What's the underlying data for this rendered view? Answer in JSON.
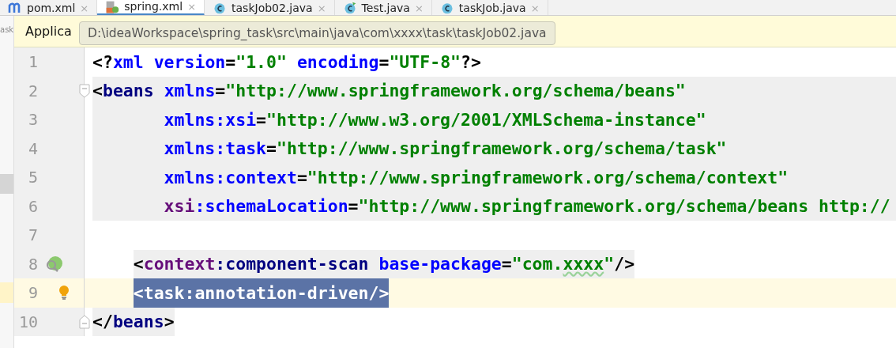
{
  "tabs": [
    {
      "label": "pom.xml",
      "kind": "maven",
      "close": "×",
      "selected": false
    },
    {
      "label": "spring.xml",
      "kind": "spring",
      "close": "×",
      "selected": true
    },
    {
      "label": "taskJob02.java",
      "kind": "class",
      "close": "×",
      "selected": false
    },
    {
      "label": "Test.java",
      "kind": "runnable",
      "close": "×",
      "selected": false
    },
    {
      "label": "taskJob.java",
      "kind": "class",
      "close": "×",
      "selected": false
    }
  ],
  "side_panel": {
    "text": "ask"
  },
  "notification": {
    "text": "Applica"
  },
  "tooltip": {
    "text": "D:\\ideaWorkspace\\spring_task\\src\\main\\java\\com\\xxxx\\task\\taskJob02.java"
  },
  "editor": {
    "lines": [
      {
        "number": "1",
        "kind": "decl",
        "highlighted": false,
        "caret": false,
        "fold_marker": false,
        "bean_marker": false,
        "bulb": false,
        "tokens": [
          {
            "kind": "punct",
            "text": "<?"
          },
          {
            "kind": "attr",
            "text": "xml version"
          },
          {
            "kind": "punct",
            "text": "="
          },
          {
            "kind": "value",
            "text": "\"1.0\" "
          },
          {
            "kind": "attr",
            "text": "encoding"
          },
          {
            "kind": "punct",
            "text": "="
          },
          {
            "kind": "value",
            "text": "\"UTF-8\""
          },
          {
            "kind": "punct",
            "text": "?>"
          }
        ]
      },
      {
        "number": "2",
        "kind": "open",
        "highlighted": true,
        "caret": false,
        "fold_marker": true,
        "bean_marker": false,
        "bulb": false,
        "tokens": [
          {
            "kind": "punct",
            "text": "<"
          },
          {
            "kind": "tag",
            "text": "beans "
          },
          {
            "kind": "attr",
            "text": "xmlns"
          },
          {
            "kind": "punct",
            "text": "="
          },
          {
            "kind": "value",
            "text": "\"http://www.springframework.org/schema/beans\""
          }
        ]
      },
      {
        "number": "3",
        "kind": "attr",
        "highlighted": true,
        "caret": false,
        "fold_marker": false,
        "bean_marker": false,
        "bulb": false,
        "tokens": [
          {
            "kind": "attr",
            "text": "xmlns:xsi"
          },
          {
            "kind": "punct",
            "text": "="
          },
          {
            "kind": "value",
            "text": "\"http://www.w3.org/2001/XMLSchema-instance\""
          }
        ]
      },
      {
        "number": "4",
        "kind": "attr",
        "highlighted": true,
        "caret": false,
        "fold_marker": false,
        "bean_marker": false,
        "bulb": false,
        "tokens": [
          {
            "kind": "attr",
            "text": "xmlns:task"
          },
          {
            "kind": "punct",
            "text": "="
          },
          {
            "kind": "value",
            "text": "\"http://www.springframework.org/schema/task\""
          }
        ]
      },
      {
        "number": "5",
        "kind": "attr",
        "highlighted": true,
        "caret": false,
        "fold_marker": false,
        "bean_marker": false,
        "bulb": false,
        "tokens": [
          {
            "kind": "attr",
            "text": "xmlns:context"
          },
          {
            "kind": "punct",
            "text": "="
          },
          {
            "kind": "value",
            "text": "\"http://www.springframework.org/schema/context\""
          }
        ]
      },
      {
        "number": "6",
        "kind": "attr",
        "highlighted": true,
        "caret": false,
        "fold_marker": false,
        "bean_marker": false,
        "bulb": false,
        "tokens": [
          {
            "kind": "ns",
            "text": "xsi"
          },
          {
            "kind": "attr",
            "text": ":schemaLocation"
          },
          {
            "kind": "punct",
            "text": "="
          },
          {
            "kind": "value",
            "text": "\"http://www.springframework.org/schema/beans http://"
          }
        ]
      },
      {
        "number": "7",
        "kind": "blank",
        "highlighted": false,
        "caret": false,
        "fold_marker": false,
        "bean_marker": false,
        "bulb": false
      },
      {
        "number": "8",
        "kind": "child",
        "highlighted": true,
        "caret": false,
        "fold_marker": false,
        "bean_marker": true,
        "bulb": false,
        "tokens": [
          {
            "kind": "punct",
            "text": "<"
          },
          {
            "kind": "ns",
            "text": "context"
          },
          {
            "kind": "tag",
            "text": ":component-scan "
          },
          {
            "kind": "attr",
            "text": "base-package"
          },
          {
            "kind": "punct",
            "text": "="
          },
          {
            "kind": "value",
            "text": "\"com."
          },
          {
            "kind": "typo",
            "text": "xxxx"
          },
          {
            "kind": "value",
            "text": "\""
          },
          {
            "kind": "punct",
            "text": "/>"
          }
        ]
      },
      {
        "number": "9",
        "kind": "child",
        "highlighted": false,
        "caret": true,
        "fold_marker": false,
        "bean_marker": false,
        "bulb": true,
        "tokens": [
          {
            "kind": "selected",
            "text": "<task:annotation-driven/>"
          }
        ]
      },
      {
        "number": "10",
        "kind": "close",
        "highlighted": true,
        "caret": false,
        "fold_marker": true,
        "bean_marker": false,
        "bulb": false,
        "tokens": [
          {
            "kind": "punct",
            "text": "</"
          },
          {
            "kind": "tag",
            "text": "beans"
          },
          {
            "kind": "punct",
            "text": ">"
          }
        ]
      }
    ]
  }
}
